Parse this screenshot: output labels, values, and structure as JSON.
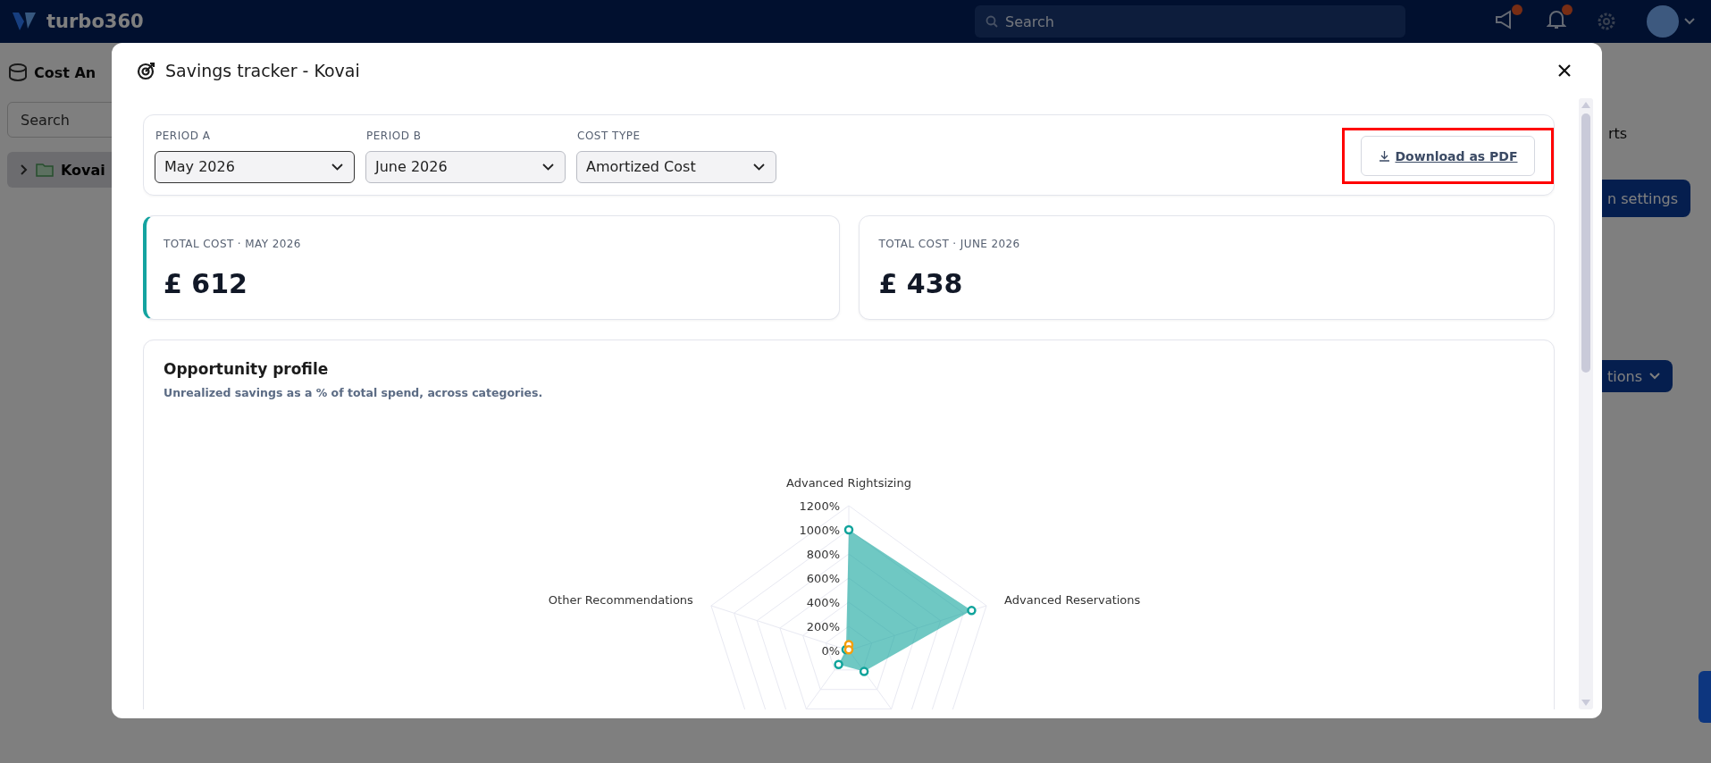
{
  "top_bar": {
    "brand": "turbo360",
    "search": {
      "placeholder": "Search"
    }
  },
  "page": {
    "title": "Cost An",
    "search": {
      "placeholder": "Search"
    },
    "tree": [
      {
        "label": "Kovai",
        "expanded": false
      }
    ],
    "tab_fragment": "rts",
    "button_fragments": [
      "n settings",
      "tions"
    ]
  },
  "modal": {
    "title": "Savings tracker - Kovai",
    "filters": [
      {
        "label": "PERIOD A",
        "value": "May 2026",
        "focused": true
      },
      {
        "label": "PERIOD B",
        "value": "June 2026",
        "focused": false
      },
      {
        "label": "COST TYPE",
        "value": "Amortized Cost",
        "focused": false
      }
    ],
    "download_button": {
      "label": "Download as PDF",
      "highlighted": true
    },
    "cost_cards": [
      {
        "label": "TOTAL COST · MAY 2026",
        "value": "£ 612",
        "accent": true
      },
      {
        "label": "TOTAL COST · JUNE 2026",
        "value": "£ 438",
        "accent": false
      }
    ],
    "opportunity": {
      "title": "Opportunity profile",
      "subtitle": "Unrealized savings as a % of total spend, across categories.",
      "radar": {
        "top_axis_label": "Advanced Rightsizing",
        "tick_labels": [
          "1200%",
          "1000%",
          "800%",
          "600%",
          "400%",
          "200%",
          "0%"
        ],
        "left_axis_label": "Other Recommendations",
        "right_axis_label": "Advanced Reservations"
      }
    }
  }
}
